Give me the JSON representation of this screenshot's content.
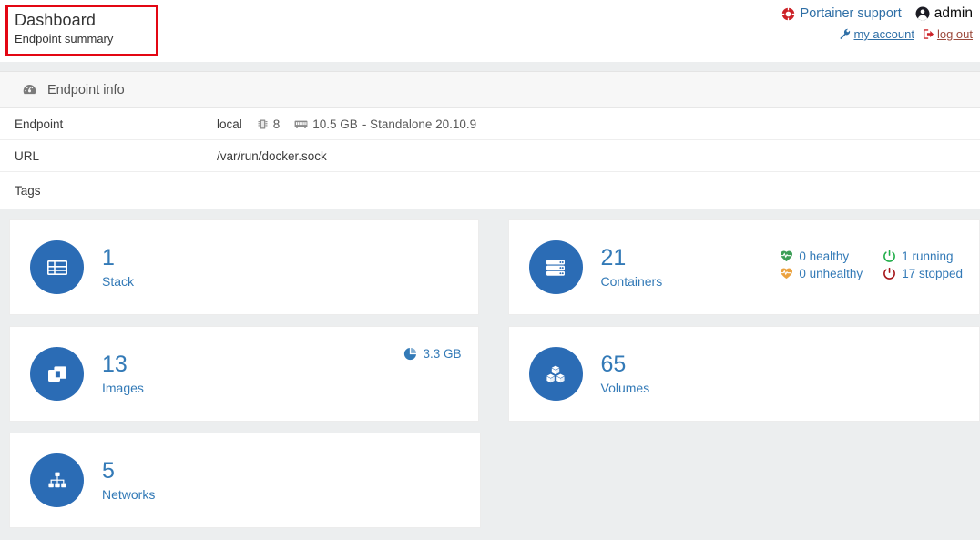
{
  "header": {
    "title": "Dashboard",
    "subtitle": "Endpoint summary",
    "support_label": "Portainer support",
    "support_icon": "life-ring-icon",
    "user_name": "admin",
    "user_icon": "user-circle-icon",
    "my_account_label": "my account",
    "my_account_icon": "wrench-icon",
    "logout_label": "log out",
    "logout_icon": "sign-out-icon",
    "accent_link_color": "#2f6fa6",
    "support_icon_color": "#cc2127",
    "logout_color": "#9c4a3c"
  },
  "endpoint_info": {
    "panel_title": "Endpoint info",
    "panel_icon": "tachometer-icon",
    "rows": [
      {
        "label": "Endpoint",
        "value_name": "local",
        "cpu_icon": "microchip-icon",
        "cpu_count": "8",
        "memory_icon": "memory-icon",
        "memory": "10.5 GB",
        "suffix": "- Standalone 20.10.9"
      },
      {
        "label": "URL",
        "value": "/var/run/docker.sock"
      },
      {
        "label": "Tags",
        "value": ""
      }
    ]
  },
  "cards": {
    "stack": {
      "value": "1",
      "label": "Stack",
      "icon": "table-layout-icon"
    },
    "containers": {
      "value": "21",
      "label": "Containers",
      "icon": "server-icon",
      "stats": [
        {
          "icon": "heartbeat-icon",
          "color": "#3d9e57",
          "text": "0 healthy"
        },
        {
          "icon": "heartbeat-icon",
          "color": "#eba23f",
          "text": "0 unhealthy"
        },
        {
          "icon": "power-icon",
          "color": "#23ae4b",
          "text": "1 running"
        },
        {
          "icon": "power-icon",
          "color": "#a6171b",
          "text": "17 stopped"
        }
      ]
    },
    "images": {
      "value": "13",
      "label": "Images",
      "icon": "clone-icon",
      "size_icon": "pie-chart-icon",
      "size": "3.3 GB"
    },
    "volumes": {
      "value": "65",
      "label": "Volumes",
      "icon": "cubes-icon"
    },
    "networks": {
      "value": "5",
      "label": "Networks",
      "icon": "sitemap-icon"
    }
  },
  "theme": {
    "circle_blue": "#2b6cb5",
    "text_blue": "#337ab7",
    "page_background": "#eceeef",
    "annotation_red": "#e30613"
  }
}
